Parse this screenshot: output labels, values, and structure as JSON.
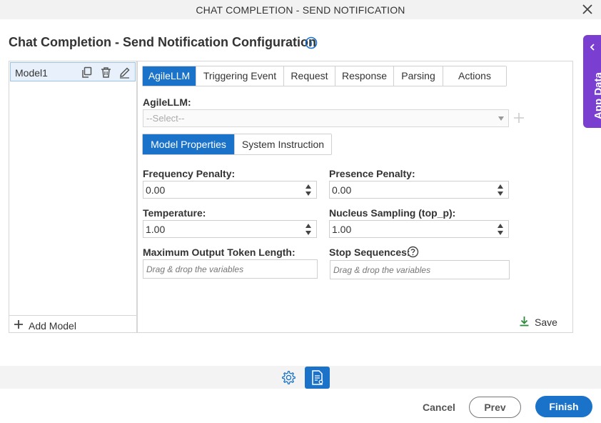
{
  "window": {
    "title": "CHAT COMPLETION - SEND NOTIFICATION"
  },
  "page": {
    "heading": "Chat Completion - Send Notification Configuration"
  },
  "app_data": {
    "label": "App Data"
  },
  "models": {
    "items": [
      {
        "label": "Model1"
      }
    ],
    "add_label": "Add Model"
  },
  "tabs": [
    {
      "label": "AgileLLM",
      "active": true
    },
    {
      "label": "Triggering Event"
    },
    {
      "label": "Request"
    },
    {
      "label": "Response"
    },
    {
      "label": "Parsing"
    },
    {
      "label": "Actions"
    }
  ],
  "agilellm": {
    "label": "AgileLLM:",
    "placeholder": "--Select--"
  },
  "subtabs": [
    {
      "label": "Model Properties",
      "active": true
    },
    {
      "label": "System Instruction"
    }
  ],
  "fields": {
    "frequency_penalty": {
      "label": "Frequency Penalty:",
      "value": "0.00"
    },
    "presence_penalty": {
      "label": "Presence Penalty:",
      "value": "0.00"
    },
    "temperature": {
      "label": "Temperature:",
      "value": "1.00"
    },
    "nucleus_sampling": {
      "label": "Nucleus Sampling (top_p):",
      "value": "1.00"
    },
    "max_tokens": {
      "label": "Maximum Output Token Length:",
      "placeholder": "Drag & drop the variables"
    },
    "stop_sequences": {
      "label": "Stop Sequences:",
      "placeholder": "Drag & drop the variables"
    }
  },
  "save_label": "Save",
  "footer": {
    "cancel": "Cancel",
    "prev": "Prev",
    "finish": "Finish"
  },
  "colors": {
    "primary": "#1a73c9",
    "app_data": "#7a3fd1",
    "save_icon": "#2e8b3a"
  }
}
